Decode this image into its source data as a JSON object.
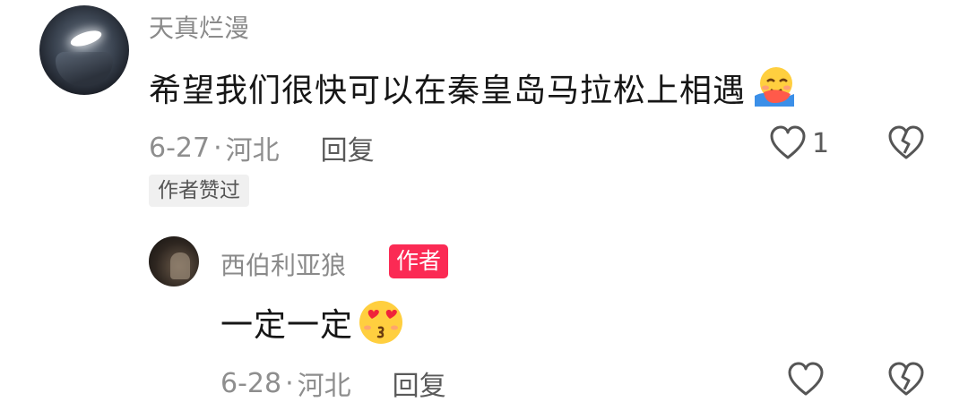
{
  "comment": {
    "username": "天真烂漫",
    "text": "希望我们很快可以在秦皇岛马拉松上相遇",
    "emoji_icon": "hugging-face-icon",
    "date": "6-27",
    "location": "河北",
    "reply_label": "回复",
    "like_count": "1",
    "liked_by_author_tag": "作者赞过"
  },
  "reply": {
    "username": "西伯利亚狼",
    "author_tag": "作者",
    "text": "一定一定",
    "emoji_icon": "heart-eyes-kiss-face-icon",
    "date": "6-28",
    "location": "河北",
    "reply_label": "回复"
  },
  "colors": {
    "author_tag_bg": "#fb2a54",
    "text_primary": "#161616",
    "text_secondary": "#8e8e8e"
  }
}
